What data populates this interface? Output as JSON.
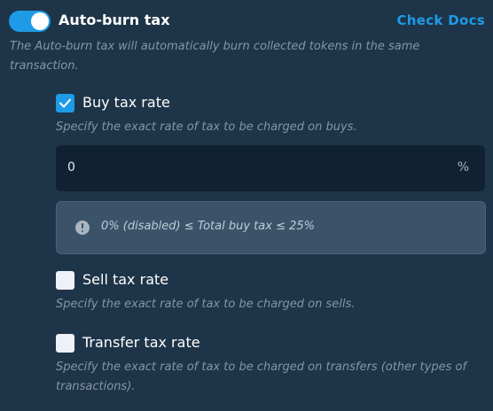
{
  "header": {
    "toggle_state": "on",
    "title": "Auto-burn tax",
    "docs_link": "Check Docs",
    "description": "The Auto-burn tax will automatically burn collected tokens in the same transaction."
  },
  "options": [
    {
      "label": "Buy tax rate",
      "checked": true,
      "description": "Specify the exact rate of tax to be charged on buys."
    },
    {
      "label": "Sell tax rate",
      "checked": false,
      "description": "Specify the exact rate of tax to be charged on sells."
    },
    {
      "label": "Transfer tax rate",
      "checked": false,
      "description": "Specify the exact rate of tax to be charged on transfers (other types of transactions)."
    }
  ],
  "buy_input": {
    "value": "0",
    "suffix": "%"
  },
  "buy_notice": {
    "icon": "info-icon",
    "text": "0% (disabled) ≤ Total buy tax ≤ 25%"
  },
  "colors": {
    "background": "#1e3448",
    "accent": "#1e9be6",
    "input_background": "#0f2132",
    "notice_background": "#3a5369",
    "muted_text": "#8396a6"
  }
}
